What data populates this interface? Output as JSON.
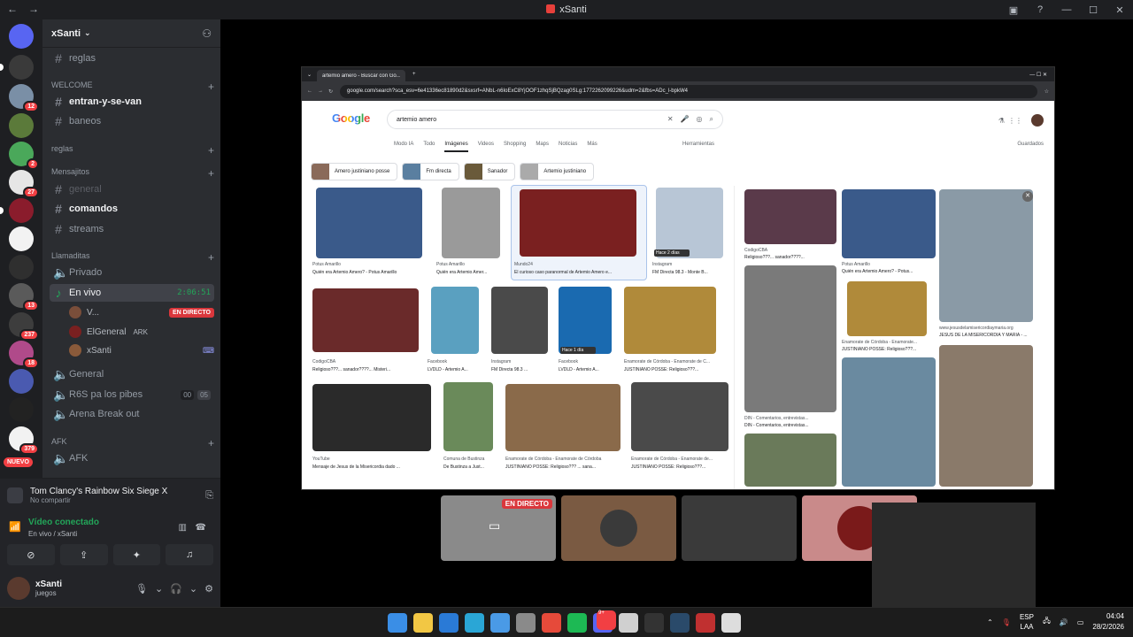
{
  "window": {
    "title": "xSanti",
    "back": "←",
    "forward": "→"
  },
  "guild_badges": [
    "12",
    "2",
    "27",
    "13",
    "237",
    "18",
    "379"
  ],
  "nuevo_label": "NUEVO",
  "server": {
    "name": "xSanti"
  },
  "channels": {
    "reglas": "reglas",
    "cat_welcome": "WELCOME",
    "entran": "entran-y-se-van",
    "baneos": "baneos",
    "cat_reglas": "reglas",
    "cat_mensajitos": "Mensajitos",
    "general_text": "general",
    "comandos": "comandos",
    "streams": "streams",
    "cat_llamaditas": "Llamaditas",
    "privado": "Privado",
    "en_vivo": "En vivo",
    "en_vivo_time": "2:06:51",
    "voice_users": [
      {
        "name": "V...",
        "badge": "EN DIRECTO"
      },
      {
        "name": "ElGeneral",
        "extra": "ARK"
      },
      {
        "name": "xSanti"
      }
    ],
    "general_voice": "General",
    "r6s": "R6S pa los pibes",
    "r6s_count_a": "00",
    "r6s_count_b": "05",
    "arena": "Arena Break out",
    "cat_afk": "AFK",
    "afk": "AFK"
  },
  "panel": {
    "game": "Tom Clancy's Rainbow Six Siege X",
    "game_sub": "No compartir",
    "voice_status": "Vídeo conectado",
    "voice_sub": "En vivo / xSanti",
    "user_name": "xSanti",
    "user_status": "juegos"
  },
  "browser": {
    "tab_title": "artemio amero - Buscar con Go...",
    "url": "google.com/search?sca_esv=6e41336ec81890d2&sxsrf=ANbL-n6IoExC8YjOOF1zhqSjBQzag0SLg:1772262099226&udm=2&fbs=ADc_l-bpkW4",
    "google": "Google",
    "query": "artemio amero",
    "tabs": [
      "Modo IA",
      "Todo",
      "Imágenes",
      "Videos",
      "Shopping",
      "Maps",
      "Noticias",
      "Más"
    ],
    "tools": "Herramientas",
    "saved": "Guardados",
    "chips": [
      "Amero justiniano posse",
      "Fm directa",
      "Sanador",
      "Artemio justiniano"
    ],
    "results": [
      {
        "source": "Potus Amarillo",
        "title": "Quién era Artemio Amero? - Potus Amarillo"
      },
      {
        "source": "Potus Amarillo",
        "title": "Quién era Artemio Amer..."
      },
      {
        "source": "Mundo24",
        "title": "El curioso caso paranormal de Artemio Amero e..."
      },
      {
        "source": "Instagram",
        "title": "FM Directa 98.3 - Monte B..."
      },
      {
        "source": "CodigoCBA",
        "title": "Religioso???... sanador????... Misteri..."
      },
      {
        "source": "Facebook",
        "title": "LVDLD - Artemio A..."
      },
      {
        "source": "Instagram",
        "title": "FM Directa 98.3 ..."
      },
      {
        "source": "Facebook",
        "title": "LVDLD - Artemio A..."
      },
      {
        "source": "Enamorate de Córdoba - Enamorate de C...",
        "title": "JUSTINIANO POSSE: Religioso???..."
      },
      {
        "source": "YouTube",
        "title": "Mensaje de Jesus de la Misericordia dado ..."
      },
      {
        "source": "Comuna de Bustinza",
        "title": "De Bustinza a Just..."
      },
      {
        "source": "Enamorate de Córdoba - Enamorate de Córdoba",
        "title": "JUSTINIANO POSSE: Religioso??? ... sana..."
      },
      {
        "source": "Enamorate de Córdoba - Enamorate de...",
        "title": "JUSTINIANO POSSE: Religioso???..."
      }
    ],
    "side_results": [
      {
        "source": "CodigoCBA",
        "title": "Religioso???... sanador????..."
      },
      {
        "source": "Potus Amarillo",
        "title": "Quién era Artemio Amero? - Potus..."
      },
      {
        "source": "www.jesusdelamisericordiaymaria.org",
        "title": "JESUS DE LA MISERICORDIA Y MARIA - ..."
      },
      {
        "source": "Enamorate de Córdoba - Enamorate...",
        "title": "JUSTINIANO POSSE: Religioso???..."
      },
      {
        "source": "DIN - Comentarios, entrevistas...",
        "title": "DIN - Comentarios, entrevistas..."
      }
    ],
    "thumb_labels": [
      "Hace 2 días",
      "Hace 1 día"
    ]
  },
  "stream_tile_label": "EN DIRECTO",
  "taskbar": {
    "lang": "ESP",
    "region": "LAA",
    "time": "04:04",
    "date": "28/2/2026",
    "badge": "9+"
  },
  "colors": {
    "accent": "#5865f2",
    "live": "#da373c",
    "voice": "#23a559"
  }
}
